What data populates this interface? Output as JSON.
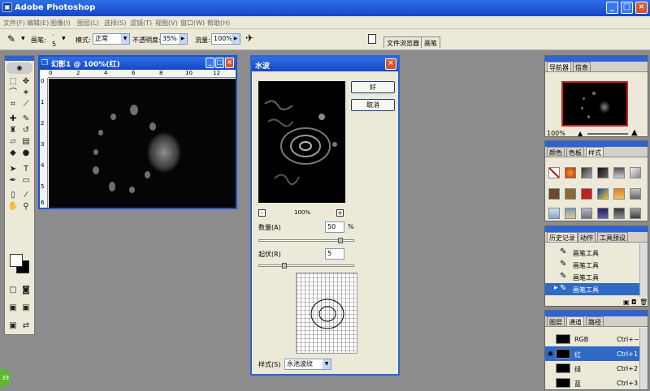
{
  "app": {
    "title": "Adobe Photoshop"
  },
  "menu": [
    "文件(F)",
    "编辑(E)",
    "图像(I)",
    "图层(L)",
    "选择(S)",
    "滤镜(T)",
    "视图(V)",
    "窗口(W)",
    "帮助(H)"
  ],
  "options": {
    "brush_label": "画笔:",
    "brush_size": "5",
    "mode_label": "模式:",
    "mode_value": "正常",
    "opacity_label": "不透明度:",
    "opacity_value": "35%",
    "flow_label": "流量:",
    "flow_value": "100%",
    "tab_browser": "文件浏览器",
    "tab_brush": "画笔"
  },
  "document": {
    "title": "幻影1 @ 100%(红)",
    "ruler_h": [
      "0",
      "2",
      "4",
      "6",
      "8",
      "10",
      "12"
    ],
    "ruler_v": [
      "0",
      "1",
      "2",
      "3",
      "4",
      "5",
      "6"
    ]
  },
  "dialog": {
    "title": "水波",
    "ok": "好",
    "cancel": "取消",
    "zoom_minus": "-",
    "zoom": "100%",
    "zoom_plus": "+",
    "amount_label": "数量(A)",
    "amount_value": "50",
    "amount_unit": "%",
    "ridges_label": "起伏(R)",
    "ridges_value": "5",
    "style_label": "样式(S)",
    "style_value": "水池波纹",
    "amount_level": 0.88,
    "ridges_level": 0.25
  },
  "navigator": {
    "tabs": [
      "导航器",
      "信息"
    ],
    "zoom": "100%"
  },
  "styles": {
    "tabs": [
      "颜色",
      "色板",
      "样式"
    ]
  },
  "history": {
    "tabs": [
      "历史记录",
      "动作",
      "工具预设"
    ],
    "items": [
      "画笔工具",
      "画笔工具",
      "画笔工具",
      "画笔工具"
    ]
  },
  "channels": {
    "tabs": [
      "图层",
      "通道",
      "路径"
    ],
    "items": [
      {
        "name": "RGB",
        "shortcut": "Ctrl+~"
      },
      {
        "name": "红",
        "shortcut": "Ctrl+1"
      },
      {
        "name": "绿",
        "shortcut": "Ctrl+2"
      },
      {
        "name": "蓝",
        "shortcut": "Ctrl+3"
      }
    ]
  },
  "badge": "39",
  "colors": {
    "titlebar": "#1546c4",
    "selection": "#316ac5",
    "chrome": "#ece9d8",
    "workspace": "#8c8c8c"
  }
}
